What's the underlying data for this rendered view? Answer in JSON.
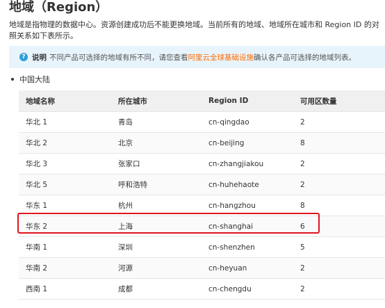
{
  "title": "地域（Region）",
  "description": "地域是指物理的数据中心。资源创建成功后不能更换地域。当前所有的地域、地域所在城市和 Region ID 的对照关系如下表所示。",
  "note": {
    "icon": "?",
    "label": "说明",
    "text_before": "不同产品可选择的地域有所不同，请您查看",
    "link": "阿里云全球基础设施",
    "text_after": "确认各产品可选择的地域列表。"
  },
  "section_bullet": "中国大陆",
  "table": {
    "headers": [
      "地域名称",
      "所在城市",
      "Region ID",
      "可用区数量"
    ],
    "rows": [
      [
        "华北 1",
        "青岛",
        "cn-qingdao",
        "2"
      ],
      [
        "华北 2",
        "北京",
        "cn-beijing",
        "8"
      ],
      [
        "华北 3",
        "张家口",
        "cn-zhangjiakou",
        "2"
      ],
      [
        "华北 5",
        "呼和浩特",
        "cn-huhehaote",
        "2"
      ],
      [
        "华东 1",
        "杭州",
        "cn-hangzhou",
        "8"
      ],
      [
        "华东 2",
        "上海",
        "cn-shanghai",
        "6"
      ],
      [
        "华南 1",
        "深圳",
        "cn-shenzhen",
        "5"
      ],
      [
        "华南 2",
        "河源",
        "cn-heyuan",
        "2"
      ],
      [
        "西南 1",
        "成都",
        "cn-chengdu",
        "2"
      ]
    ]
  },
  "colors": {
    "note_background": "#e8f4fb",
    "note_icon": "#2f9fd8",
    "link": "#ff6a00",
    "highlight": "#e0141e",
    "header_background": "#f0f0f0"
  }
}
